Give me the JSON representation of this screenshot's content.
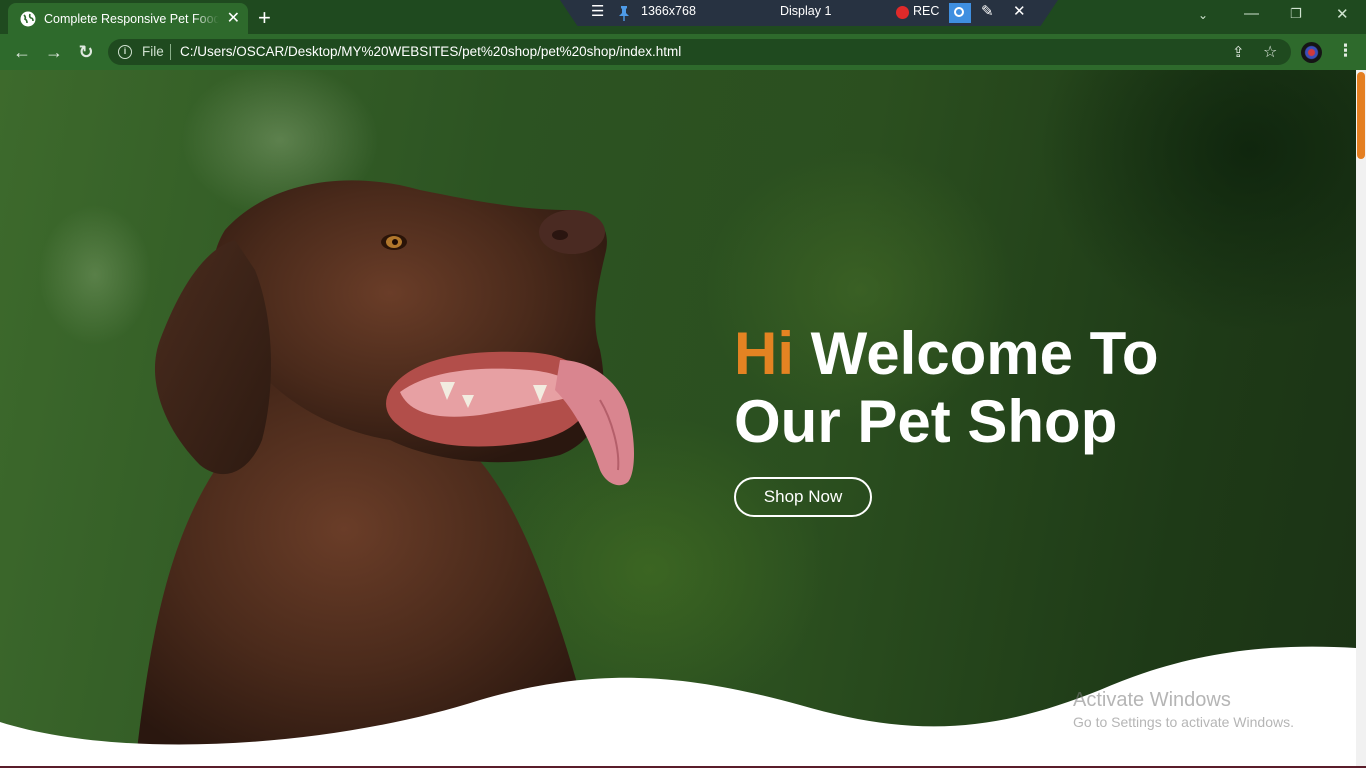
{
  "browser": {
    "tab_title": "Complete Responsive Pet Food Website",
    "tab_close": "✕",
    "new_tab": "+",
    "file_label": "File",
    "url": "C:/Users/OSCAR/Desktop/MY%20WEBSITES/pet%20shop/pet%20shop/index.html"
  },
  "recorder": {
    "resolution": "1366x768",
    "display": "Display 1",
    "rec_label": "REC"
  },
  "hero": {
    "greeting": "Hi",
    "title_line1": "Welcome To",
    "title_line2": "Our Pet Shop",
    "button_label": "Shop Now"
  },
  "watermark": {
    "title": "Activate Windows",
    "subtitle": "Go to Settings to activate Windows."
  },
  "colors": {
    "accent": "#e48322",
    "chrome_dark": "#1f4a1f",
    "chrome": "#2e6a2c"
  },
  "icons": [
    "globe-icon",
    "close-icon",
    "plus-icon",
    "menu-icon",
    "pin-icon",
    "record-icon",
    "camera-icon",
    "pen-icon",
    "back-icon",
    "forward-icon",
    "reload-icon",
    "info-icon",
    "share-icon",
    "star-icon",
    "profile-avatar",
    "more-icon"
  ]
}
